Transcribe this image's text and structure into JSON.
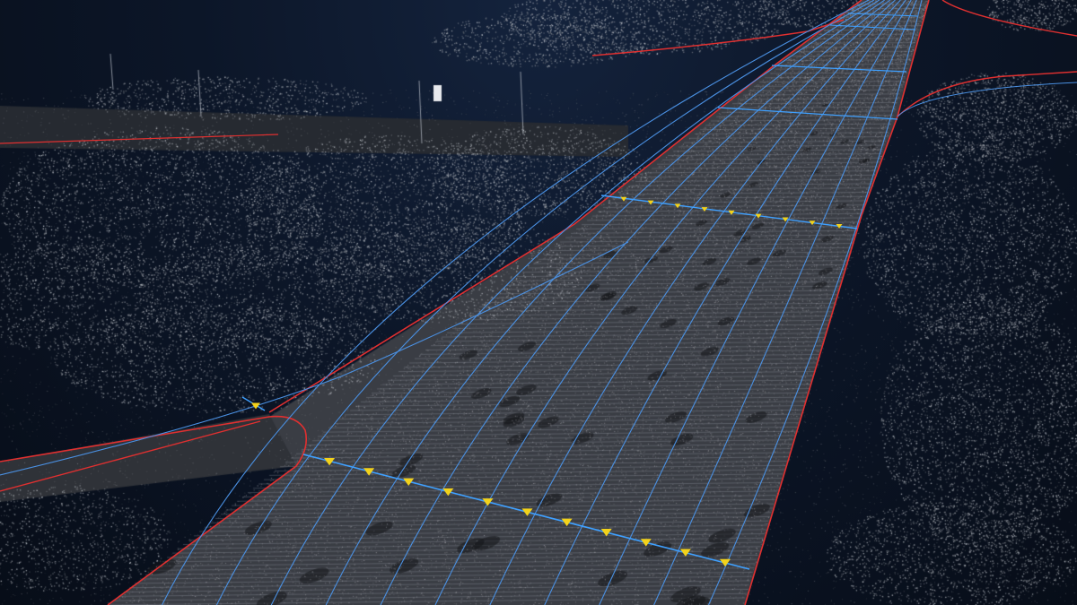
{
  "scene": {
    "kind": "lidar-point-cloud-hd-map",
    "colors": {
      "sky": "#0c1628",
      "points": "#b8bcc4",
      "points_dim": "#6e7480",
      "road_surface": "#3a3d44",
      "lane_line": "#4a90e2",
      "road_edge": "#e03030",
      "stop_line": "#3fa0ff",
      "marker": "#f2d21b"
    },
    "layers": [
      {
        "name": "point-cloud",
        "visible": true
      },
      {
        "name": "lane-centerlines",
        "visible": true
      },
      {
        "name": "road-boundaries",
        "visible": true
      },
      {
        "name": "stop-lines",
        "visible": true
      },
      {
        "name": "direction-markers",
        "visible": true
      }
    ]
  }
}
